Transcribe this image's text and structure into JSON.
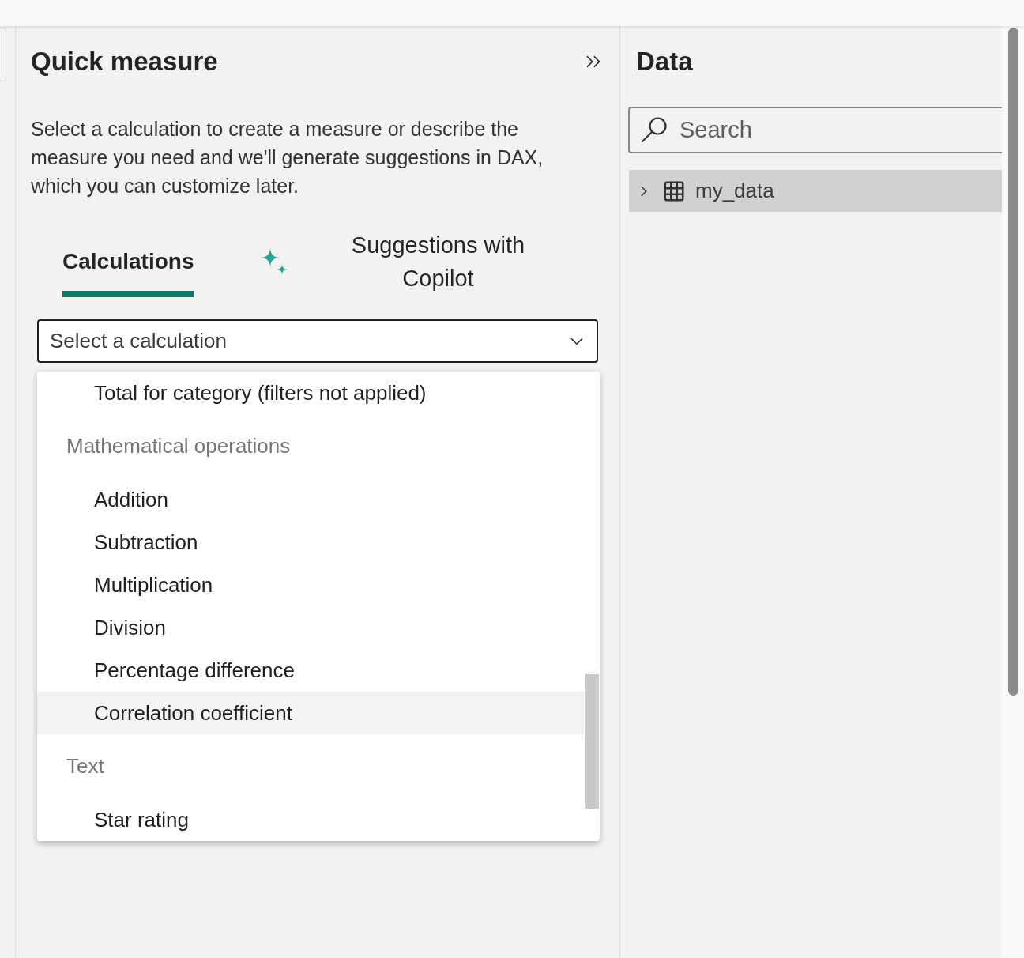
{
  "quick_measure_pane": {
    "title": "Quick measure",
    "description": "Select a calculation to create a measure or describe the measure you need and we'll generate suggestions in DAX, which you can customize later.",
    "tabs": [
      {
        "kind": "plain",
        "label": "Calculations",
        "selected": true
      },
      {
        "kind": "copilot",
        "label": "Suggestions with Copilot",
        "selected": false
      }
    ],
    "calculation_select": {
      "placeholder": "Select a calculation",
      "expanded": true,
      "options": [
        {
          "kind": "option",
          "label": "Total for category (filters not applied)",
          "highlighted": false
        },
        {
          "kind": "header",
          "label": "Mathematical operations"
        },
        {
          "kind": "option",
          "label": "Addition",
          "highlighted": false
        },
        {
          "kind": "option",
          "label": "Subtraction",
          "highlighted": false
        },
        {
          "kind": "option",
          "label": "Multiplication",
          "highlighted": false
        },
        {
          "kind": "option",
          "label": "Division",
          "highlighted": false
        },
        {
          "kind": "option",
          "label": "Percentage difference",
          "highlighted": false
        },
        {
          "kind": "option",
          "label": "Correlation coefficient",
          "highlighted": true
        },
        {
          "kind": "header",
          "label": "Text"
        },
        {
          "kind": "option",
          "label": "Star rating",
          "highlighted": false
        }
      ]
    }
  },
  "data_pane": {
    "title": "Data",
    "search": {
      "placeholder": "Search"
    },
    "tables": [
      {
        "name": "my_data",
        "expanded": false,
        "highlighted": true
      }
    ]
  }
}
